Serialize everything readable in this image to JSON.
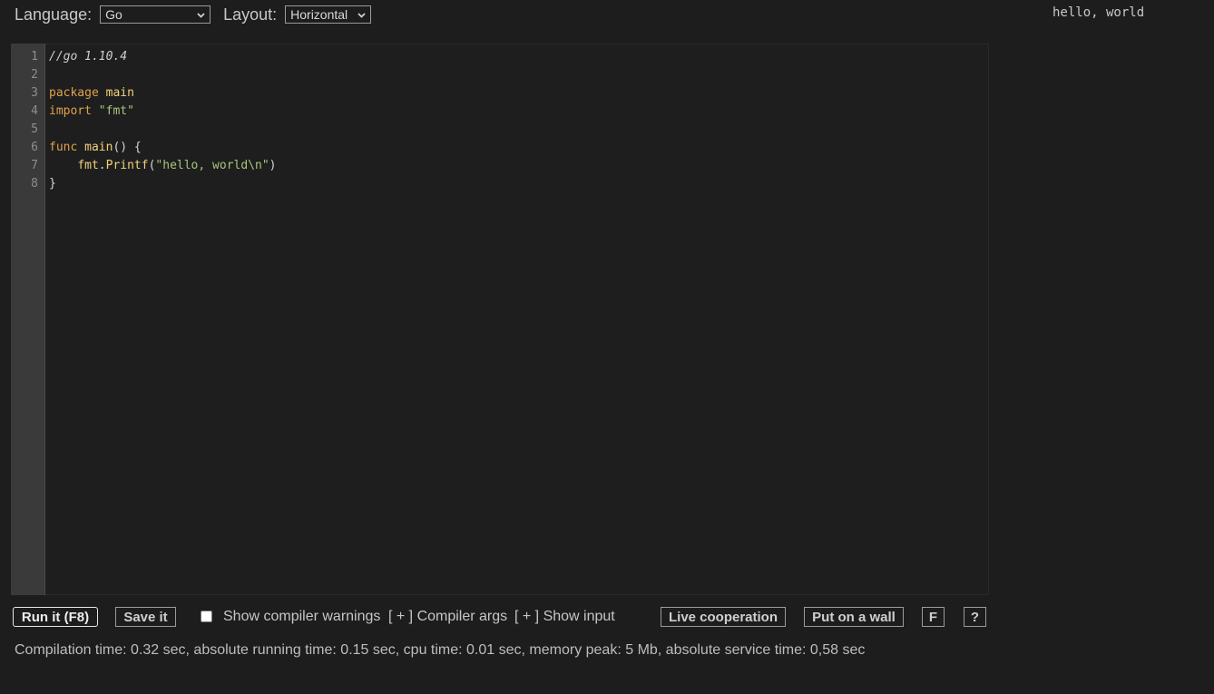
{
  "header": {
    "language_label": "Language:",
    "language_value": "Go",
    "layout_label": "Layout:",
    "layout_value": "Horizontal"
  },
  "output": {
    "text": "hello, world"
  },
  "editor": {
    "line_numbers": [
      "1",
      "2",
      "3",
      "4",
      "5",
      "6",
      "7",
      "8"
    ],
    "lines": [
      [
        {
          "t": "//go 1.10.4",
          "c": "cmt"
        }
      ],
      [],
      [
        {
          "t": "package ",
          "c": "kw"
        },
        {
          "t": "main",
          "c": "ident"
        }
      ],
      [
        {
          "t": "import ",
          "c": "kw"
        },
        {
          "t": "\"fmt\"",
          "c": "str"
        }
      ],
      [],
      [
        {
          "t": "func ",
          "c": "kw"
        },
        {
          "t": "main",
          "c": "ident"
        },
        {
          "t": "() {",
          "c": "plain"
        }
      ],
      [
        {
          "t": "    ",
          "c": "plain"
        },
        {
          "t": "fmt",
          "c": "ident"
        },
        {
          "t": ".",
          "c": "plain"
        },
        {
          "t": "Printf",
          "c": "ident"
        },
        {
          "t": "(",
          "c": "plain"
        },
        {
          "t": "\"hello, world\\n\"",
          "c": "str"
        },
        {
          "t": ")",
          "c": "plain"
        }
      ],
      [
        {
          "t": "}",
          "c": "plain"
        }
      ]
    ]
  },
  "toolbar": {
    "run_label": "Run it (F8)",
    "save_label": "Save it",
    "warnings_label": "Show compiler warnings",
    "warnings_checked": false,
    "compiler_args_label": "[ + ] Compiler args",
    "show_input_label": "[ + ] Show input",
    "live_coop_label": "Live cooperation",
    "wall_label": "Put on a wall",
    "f_label": "F",
    "help_label": "?"
  },
  "status": {
    "text": "Compilation time: 0.32 sec, absolute running time: 0.15 sec, cpu time: 0.01 sec, memory peak: 5 Mb, absolute service time: 0,58 sec"
  },
  "colors": {
    "background": "#1d1d1d",
    "editor_bg": "#1e1e1e",
    "gutter_bg": "#3a3a3a",
    "keyword": "#e0a24b",
    "identifier": "#f2d17a",
    "string": "#a8c47c"
  }
}
